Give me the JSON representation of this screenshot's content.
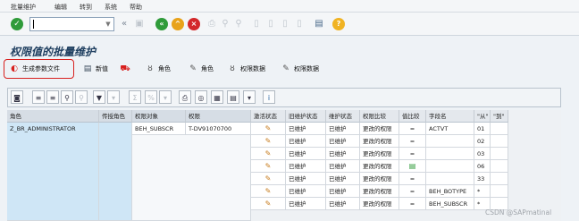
{
  "menu": [
    "批量维护",
    "编辑",
    "转到",
    "系统",
    "帮助"
  ],
  "page_title": "权限值的批量维护",
  "app_toolbar": {
    "generate_profile": "生成参数文件",
    "new": "新值",
    "role1": "角色",
    "role2": "角色",
    "auth_data1": "权限数据",
    "auth_data2": "权限数据"
  },
  "table": {
    "headers": [
      "角色",
      "传授角色",
      "权限对象",
      "权限",
      "激活状态",
      "旧维护状态",
      "维护状态",
      "权限比较",
      "值比较",
      "字段名",
      "\"从\"",
      "\"到\""
    ],
    "role_row": {
      "role": "Z_BR_ADMINISTRATOR",
      "object": "BEH_SUBSCR",
      "auth": "T-DV91070700"
    },
    "rows": [
      {
        "old": "已维护",
        "status": "已维护",
        "compare": "更改的权限",
        "val": "=",
        "field": "ACTVT",
        "from": "01"
      },
      {
        "old": "已维护",
        "status": "已维护",
        "compare": "更改的权限",
        "val": "=",
        "field": "",
        "from": "02"
      },
      {
        "old": "已维护",
        "status": "已维护",
        "compare": "更改的权限",
        "val": "=",
        "field": "",
        "from": "03"
      },
      {
        "old": "已维护",
        "status": "已维护",
        "compare": "更改的权限",
        "val": "",
        "field": "",
        "from": "06"
      },
      {
        "old": "已维护",
        "status": "已维护",
        "compare": "更改的权限",
        "val": "=",
        "field": "",
        "from": "33"
      },
      {
        "old": "已维护",
        "status": "已维护",
        "compare": "更改的权限",
        "val": "=",
        "field": "BEH_BOTYPE",
        "from": "*"
      },
      {
        "old": "已维护",
        "status": "已维护",
        "compare": "更改的权限",
        "val": "=",
        "field": "BEH_SUBSCR",
        "from": "*"
      }
    ]
  },
  "watermark": "CSDN @SAPmatinal"
}
